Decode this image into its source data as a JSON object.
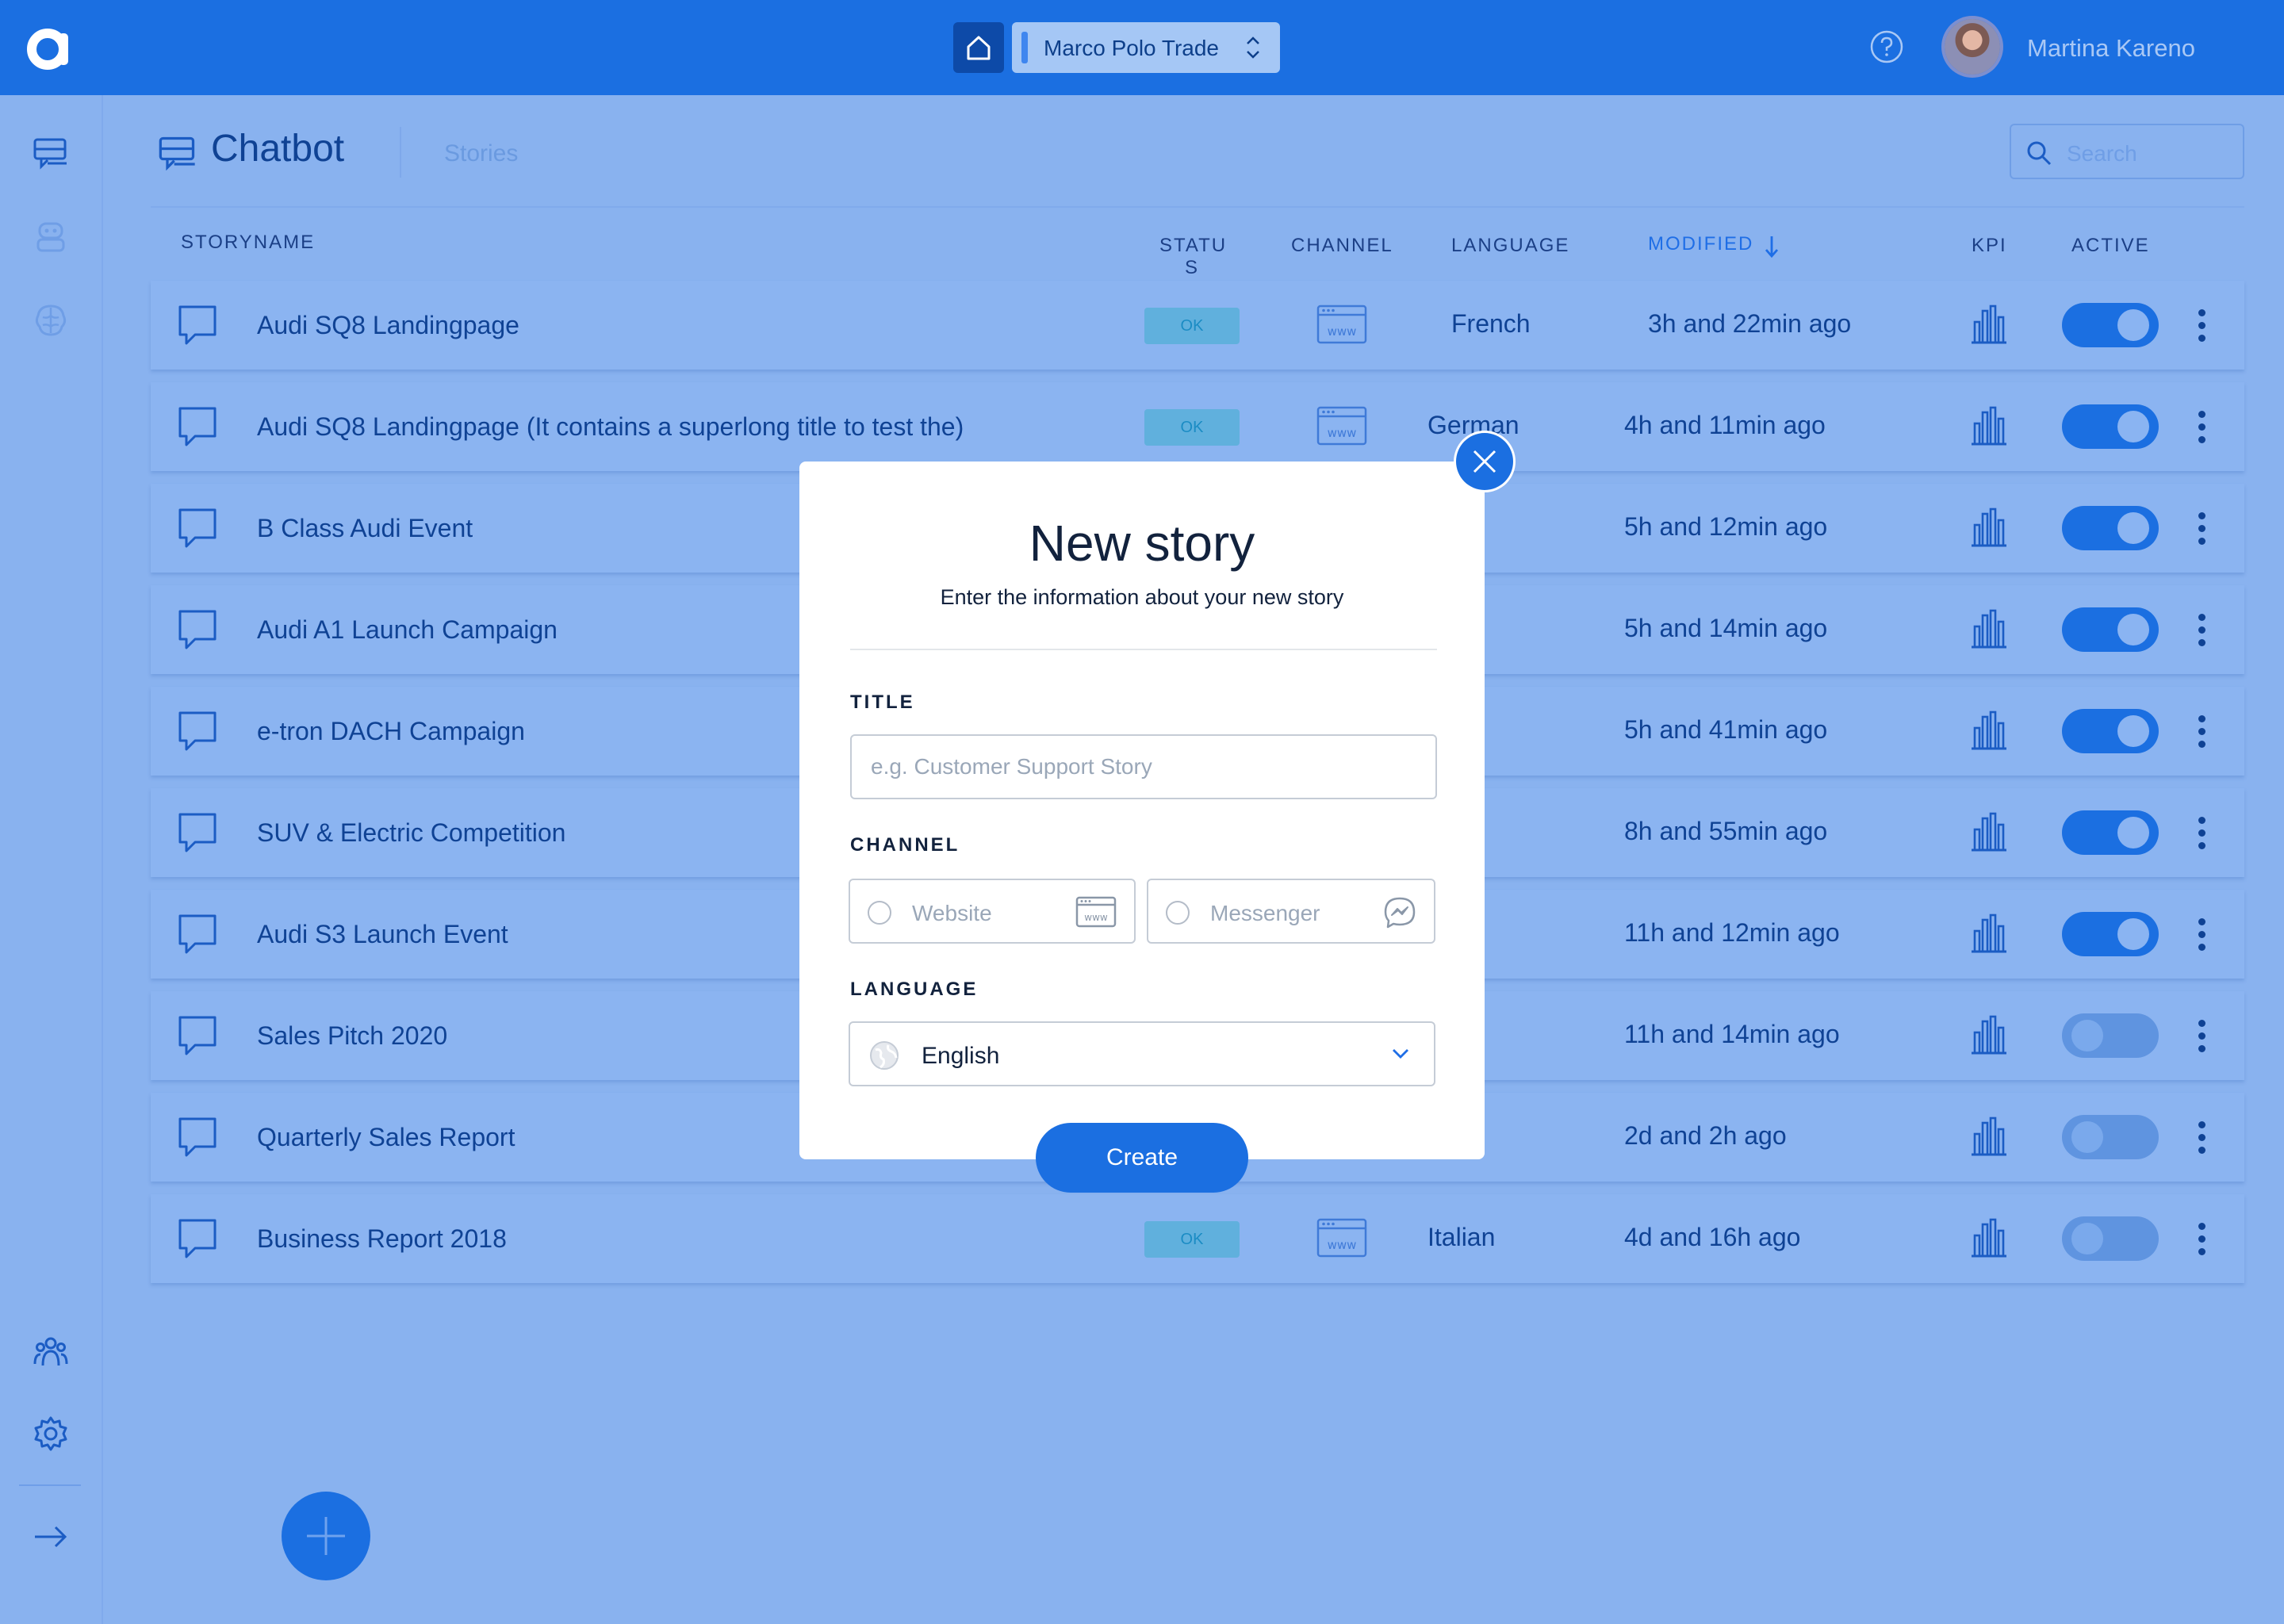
{
  "topbar": {
    "workspace": "Marco Polo Trade",
    "user_name": "Martina Kareno"
  },
  "header": {
    "title": "Chatbot",
    "tab_stories": "Stories",
    "search_placeholder": "Search"
  },
  "table": {
    "columns": {
      "storyname": "STORYNAME",
      "status_line1": "STATU",
      "status_line2": "S",
      "channel": "CHANNEL",
      "language": "LANGUAGE",
      "modified": "MODIFIED",
      "kpi": "KPI",
      "active": "ACTIVE"
    },
    "rows": [
      {
        "name": "Audi SQ8 Landingpage",
        "status": "OK",
        "language": "French",
        "modified": "3h and 22min ago",
        "active": true
      },
      {
        "name": "Audi SQ8 Landingpage (It contains a superlong title to test the)",
        "status": "OK",
        "language": "German",
        "modified": "4h and 11min ago",
        "active": true
      },
      {
        "name": "B Class Audi Event",
        "status": "",
        "language": "sh",
        "modified": "5h and 12min ago",
        "active": true
      },
      {
        "name": "Audi A1 Launch Campaign",
        "status": "",
        "language": "sh",
        "modified": "5h and 14min ago",
        "active": true
      },
      {
        "name": "e-tron DACH Campaign",
        "status": "",
        "language": "nan",
        "modified": "5h and 41min ago",
        "active": true
      },
      {
        "name": "SUV & Electric Competition",
        "status": "",
        "language": "nan",
        "modified": "8h and 55min ago",
        "active": true
      },
      {
        "name": "Audi S3 Launch Event",
        "status": "",
        "language": "nan",
        "modified": "11h and 12min ago",
        "active": true
      },
      {
        "name": "Sales Pitch 2020",
        "status": "",
        "language": "nan",
        "modified": "11h and 14min ago",
        "active": false
      },
      {
        "name": "Quarterly Sales Report",
        "status": "",
        "language": "ench",
        "modified": "2d and 2h ago",
        "active": false
      },
      {
        "name": "Business Report 2018",
        "status": "OK",
        "language": "Italian",
        "modified": "4d and 16h ago",
        "active": false
      }
    ]
  },
  "modal": {
    "title": "New story",
    "subtitle": "Enter the information about your new story",
    "title_label": "TITLE",
    "title_placeholder": "e.g. Customer Support Story",
    "channel_label": "CHANNEL",
    "channel_options": [
      "Website",
      "Messenger"
    ],
    "language_label": "LANGUAGE",
    "language_value": "English",
    "create_label": "Create"
  }
}
